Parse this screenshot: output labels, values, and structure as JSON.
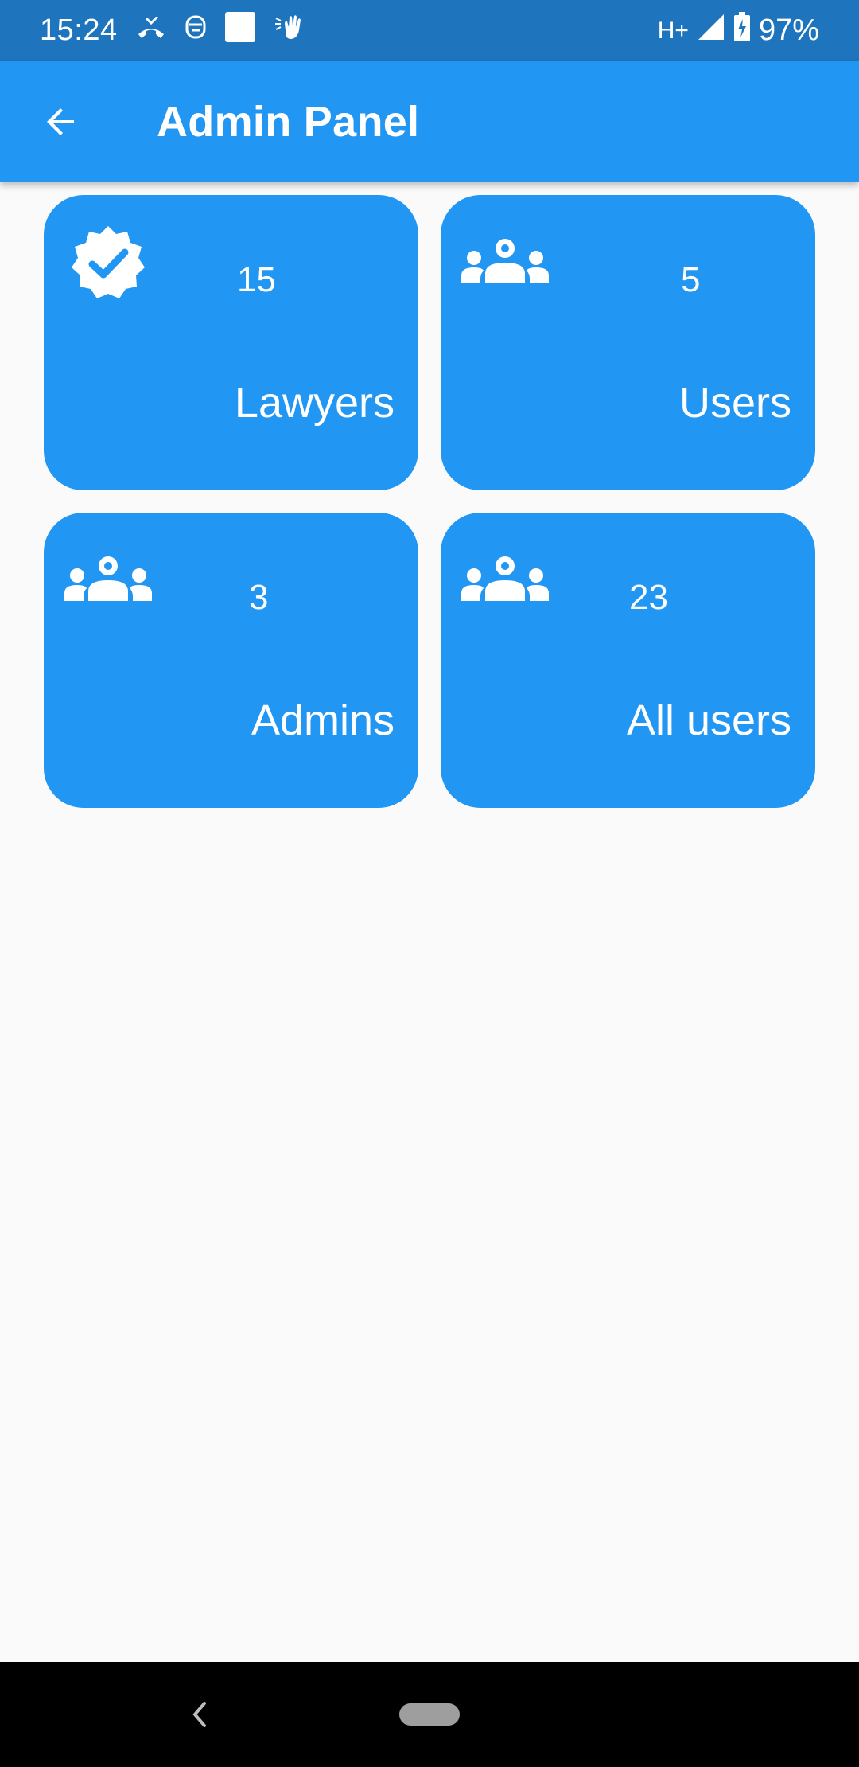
{
  "status_bar": {
    "time": "15:24",
    "network": "H+",
    "battery": "97%"
  },
  "app_bar": {
    "title": "Admin Panel"
  },
  "cards": [
    {
      "count": "15",
      "label": "Lawyers",
      "icon": "verified-badge-icon"
    },
    {
      "count": "5",
      "label": "Users",
      "icon": "group-icon"
    },
    {
      "count": "3",
      "label": "Admins",
      "icon": "group-icon"
    },
    {
      "count": "23",
      "label": "All users",
      "icon": "group-icon"
    }
  ],
  "colors": {
    "primary": "#2196f3",
    "status_bar": "#1e74bd",
    "background": "#fafafa"
  }
}
